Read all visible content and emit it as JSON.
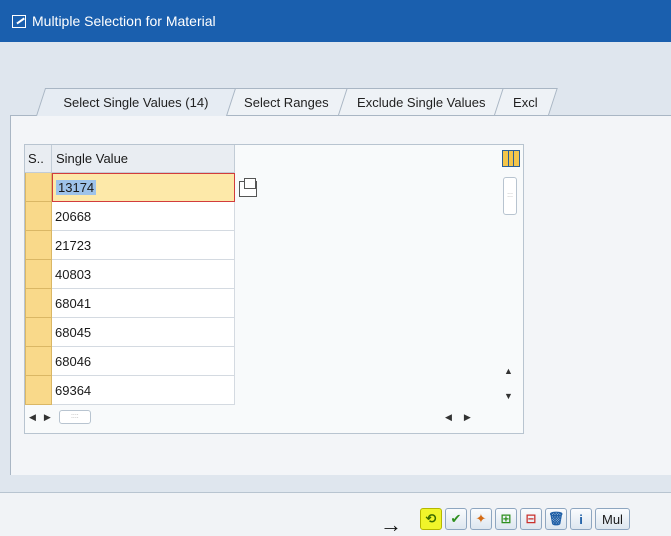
{
  "window": {
    "title": "Multiple Selection for Material"
  },
  "tabs": [
    {
      "label": "Select Single Values (14)"
    },
    {
      "label": "Select Ranges"
    },
    {
      "label": "Exclude Single Values"
    },
    {
      "label": "Excl"
    }
  ],
  "grid": {
    "headers": {
      "sel": "S..",
      "value": "Single Value"
    },
    "rows": [
      "13174",
      "20668",
      "21723",
      "40803",
      "68041",
      "68045",
      "68046",
      "69364"
    ]
  },
  "scroll": {
    "v_thumb": ":::",
    "h_thumb": "::::",
    "up": "▲",
    "down": "▼",
    "left": "◀",
    "right": "▶"
  },
  "toolbar": {
    "arrow": "→",
    "execute_icon": "⟲",
    "check_icon": "✔",
    "multi_icon": "✦",
    "insert_icon": "⊞",
    "delete_row_icon": "⊟",
    "trash_icon": "🗑",
    "info_icon": "i",
    "multiple_label": "Mul"
  },
  "colors": {
    "titlebar": "#1a5fae",
    "highlight": "#f0f52a",
    "selected_cell": "#fde9a9"
  }
}
